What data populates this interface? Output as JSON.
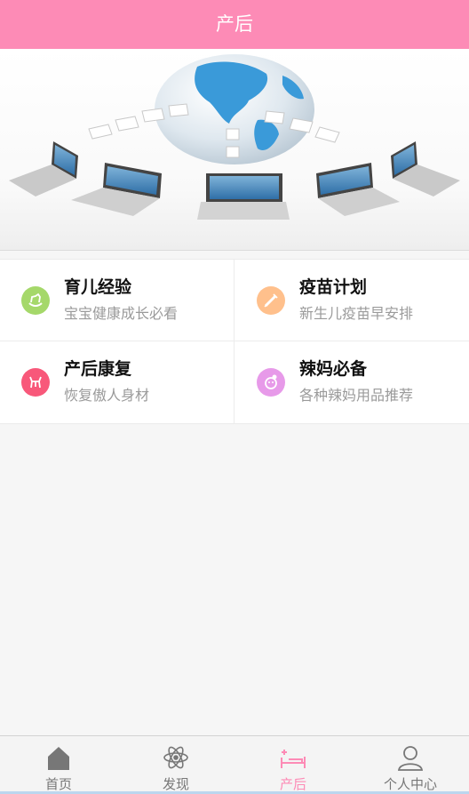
{
  "header": {
    "title": "产后"
  },
  "banner": {
    "image": "globe-network-laptops-illustration"
  },
  "menu": [
    {
      "title": "育儿经验",
      "subtitle": "宝宝健康成长必看",
      "icon": "rocking-horse-icon",
      "color": "#a5d86a"
    },
    {
      "title": "疫苗计划",
      "subtitle": "新生儿疫苗早安排",
      "icon": "syringe-icon",
      "color": "#ffc08c"
    },
    {
      "title": "产后康复",
      "subtitle": "恢复傲人身材",
      "icon": "toy-horse-icon",
      "color": "#f8587a"
    },
    {
      "title": "辣妈必备",
      "subtitle": "各种辣妈用品推荐",
      "icon": "baby-face-icon",
      "color": "#e79ae9"
    }
  ],
  "tabs": [
    {
      "label": "首页",
      "icon": "home-icon",
      "active": false
    },
    {
      "label": "发现",
      "icon": "atom-icon",
      "active": false
    },
    {
      "label": "产后",
      "icon": "bed-icon",
      "active": true
    },
    {
      "label": "个人中心",
      "icon": "user-icon",
      "active": false
    }
  ],
  "colors": {
    "accent": "#fd8bb6",
    "inactive": "#777777"
  }
}
